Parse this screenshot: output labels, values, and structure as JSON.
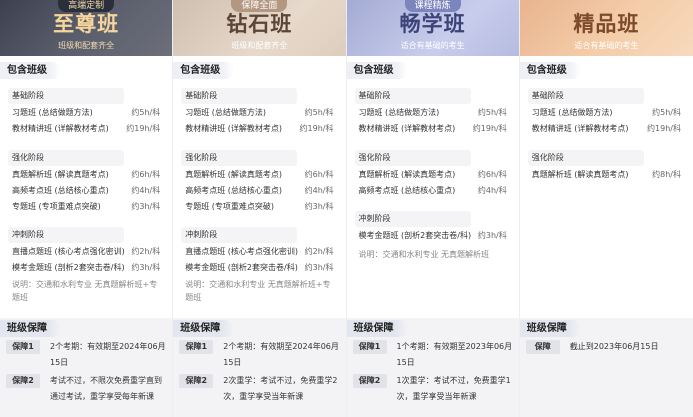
{
  "plans": [
    {
      "ribbon": "高端定制",
      "title": "至尊班",
      "subtitle": "班级和配套齐全",
      "include_label": "包含班级",
      "stages": [
        {
          "name": "基础阶段",
          "rows": [
            {
              "course": "习题班 (总结做题方法)",
              "hours": "约5h/科"
            },
            {
              "course": "教材精讲班 (详解教材考点)",
              "hours": "约19h/科"
            }
          ]
        },
        {
          "name": "强化阶段",
          "rows": [
            {
              "course": "真题解析班 (解读真题考点)",
              "hours": "约6h/科"
            },
            {
              "course": "高频考点班 (总结核心重点)",
              "hours": "约4h/科"
            },
            {
              "course": "专题班 (专项重难点突破)",
              "hours": "约3h/科"
            }
          ]
        },
        {
          "name": "冲刺阶段",
          "rows": [
            {
              "course": "直播点题班 (核心考点强化密训)",
              "hours": "约2h/科"
            },
            {
              "course": "模考金题班 (剖析2套突击卷/科)",
              "hours": "约3h/科"
            }
          ]
        }
      ],
      "note": "说明：交通和水利专业 无真题解析班+专题班",
      "guarantee_label": "班级保障",
      "guarantees": [
        {
          "badge": "保障1",
          "text": "2个考期：有效期至2024年06月15日"
        },
        {
          "badge": "保障2",
          "text": "考试不过，不限次免费重学直到通过考试，重学享受每年新课"
        }
      ]
    },
    {
      "ribbon": "保障全面",
      "title": "钻石班",
      "subtitle": "班级和配套齐全",
      "include_label": "包含班级",
      "stages": [
        {
          "name": "基础阶段",
          "rows": [
            {
              "course": "习题班 (总结做题方法)",
              "hours": "约5h/科"
            },
            {
              "course": "教材精讲班 (详解教材考点)",
              "hours": "约19h/科"
            }
          ]
        },
        {
          "name": "强化阶段",
          "rows": [
            {
              "course": "真题解析班 (解读真题考点)",
              "hours": "约6h/科"
            },
            {
              "course": "高频考点班 (总结核心重点)",
              "hours": "约4h/科"
            },
            {
              "course": "专题班 (专项重难点突破)",
              "hours": "约3h/科"
            }
          ]
        },
        {
          "name": "冲刺阶段",
          "rows": [
            {
              "course": "直播点题班 (核心考点强化密训)",
              "hours": "约2h/科"
            },
            {
              "course": "模考金题班 (剖析2套突击卷/科)",
              "hours": "约3h/科"
            }
          ]
        }
      ],
      "note": "说明：交通和水利专业 无真题解析班+专题班",
      "guarantee_label": "班级保障",
      "guarantees": [
        {
          "badge": "保障1",
          "text": "2个考期：有效期至2024年06月15日"
        },
        {
          "badge": "保障2",
          "text": "2次重学：考试不过，免费重学2次，重学享受当年新课"
        }
      ]
    },
    {
      "ribbon": "课程精炼",
      "title": "畅学班",
      "subtitle": "适合有基础的考生",
      "include_label": "包含班级",
      "stages": [
        {
          "name": "基础阶段",
          "rows": [
            {
              "course": "习题班 (总结做题方法)",
              "hours": "约5h/科"
            },
            {
              "course": "教材精讲班 (详解教材考点)",
              "hours": "约19h/科"
            }
          ]
        },
        {
          "name": "强化阶段",
          "rows": [
            {
              "course": "真题解析班 (解读真题考点)",
              "hours": "约6h/科"
            },
            {
              "course": "高频考点班 (总结核心重点)",
              "hours": "约4h/科"
            }
          ]
        },
        {
          "name": "冲刺阶段",
          "rows": [
            {
              "course": "模考金题班 (剖析2套突击卷/科)",
              "hours": "约3h/科"
            }
          ]
        }
      ],
      "note": "说明：交通和水利专业 无真题解析班",
      "guarantee_label": "班级保障",
      "guarantees": [
        {
          "badge": "保障1",
          "text": "1个考期：有效期至2023年06月15日"
        },
        {
          "badge": "保障2",
          "text": "1次重学：考试不过，免费重学1次，重学享受当年新课"
        }
      ]
    },
    {
      "ribbon": "",
      "title": "精品班",
      "subtitle": "适合有基础的考生",
      "include_label": "包含班级",
      "stages": [
        {
          "name": "基础阶段",
          "rows": [
            {
              "course": "习题班 (总结做题方法)",
              "hours": "约5h/科"
            },
            {
              "course": "教材精讲班 (详解教材考点)",
              "hours": "约19h/科"
            }
          ]
        },
        {
          "name": "强化阶段",
          "rows": [
            {
              "course": "真题解析班 (解读真题考点)",
              "hours": "约8h/科"
            }
          ]
        }
      ],
      "note": "",
      "guarantee_label": "班级保障",
      "guarantees": [
        {
          "badge": "保障",
          "text": "截止到2023年06月15日"
        }
      ]
    }
  ]
}
